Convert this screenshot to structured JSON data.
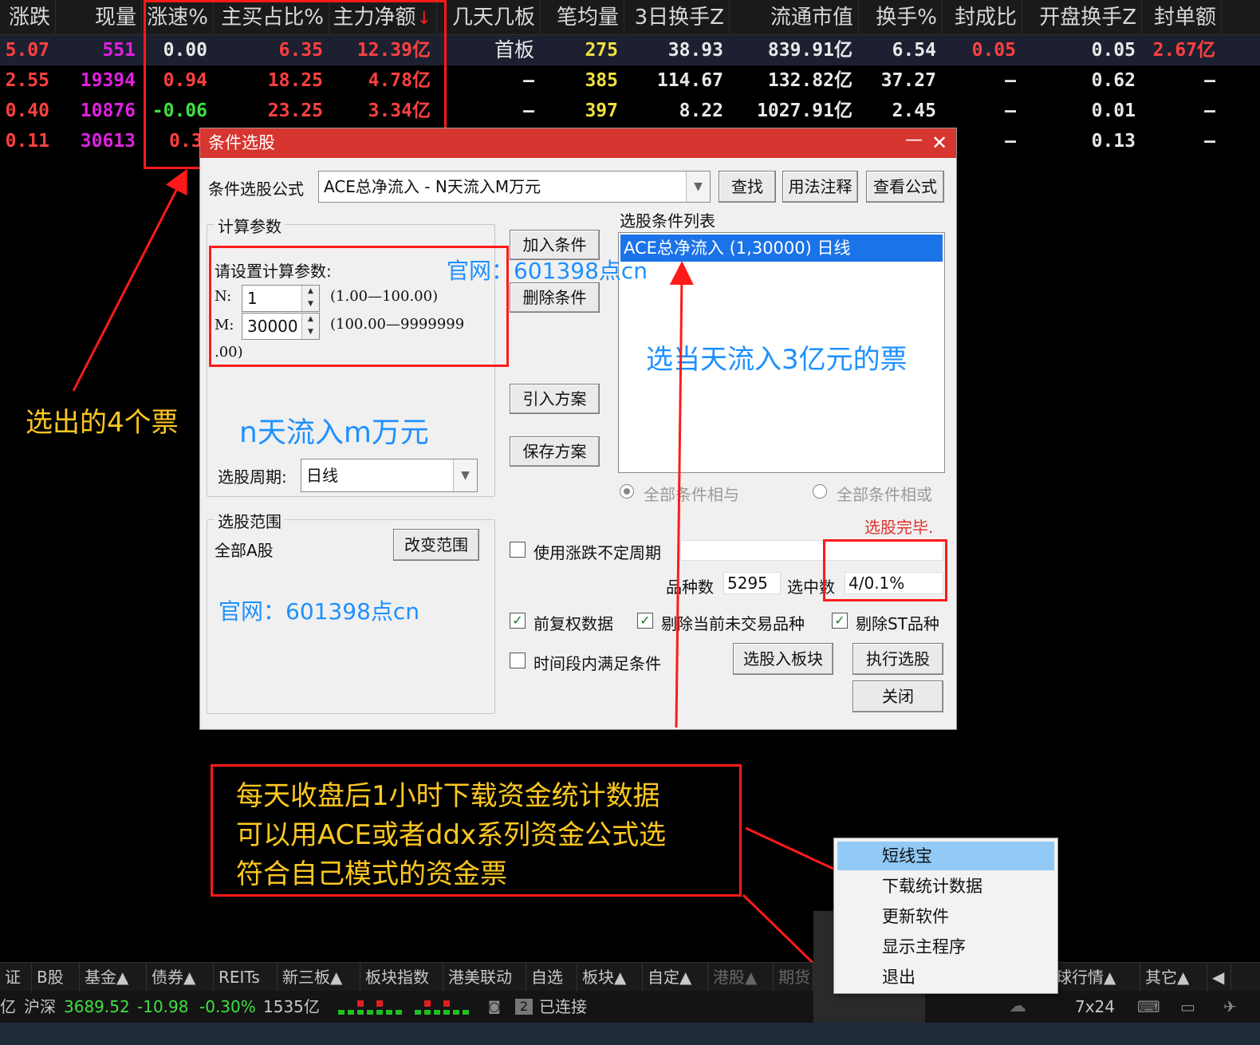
{
  "table": {
    "headers": [
      "涨跌",
      "现量",
      "涨速%",
      "主买占比%",
      "主力净额",
      "几天几板",
      "笔均量",
      "3日换手Z",
      "流通市值",
      "换手%",
      "封成比",
      "开盘换手Z",
      "封单额"
    ],
    "sort_arrow": "↓",
    "rows": [
      [
        "5.07",
        "551",
        "0.00",
        "6.35",
        "12.39亿",
        "首板",
        "275",
        "38.93",
        "839.91亿",
        "6.54",
        "0.05",
        "0.05",
        "2.67亿"
      ],
      [
        "2.55",
        "19394",
        "0.94",
        "18.25",
        "4.78亿",
        "—",
        "385",
        "114.67",
        "132.82亿",
        "37.27",
        "—",
        "0.62",
        "—"
      ],
      [
        "0.40",
        "10876",
        "-0.06",
        "23.25",
        "3.34亿",
        "—",
        "397",
        "8.22",
        "1027.91亿",
        "2.45",
        "—",
        "0.01",
        "—"
      ],
      [
        "0.11",
        "30613",
        "0.3",
        "",
        "",
        "",
        "",
        "",
        "",
        "",
        "—",
        "0.13",
        "—"
      ]
    ]
  },
  "dialog": {
    "title": "条件选股",
    "min_glyph": "—",
    "close_glyph": "✕",
    "formula_label": "条件选股公式",
    "formula_value": "ACE总净流入 - N天流入M万元",
    "find_btn": "查找",
    "usage_btn": "用法注释",
    "view_formula_btn": "查看公式",
    "calc_group": "计算参数",
    "set_params": "请设置计算参数:",
    "n_label": "N:",
    "n_value": "1",
    "n_range": "(1.00—100.00)",
    "m_label": "M:",
    "m_value": "30000",
    "m_range": "(100.00—9999999",
    "m_range_cont": ".00)",
    "add_cond": "加入条件",
    "del_cond": "删除条件",
    "import_plan": "引入方案",
    "save_plan": "保存方案",
    "cond_list_label": "选股条件列表",
    "cond_list_item": "ACE总净流入 (1,30000) 日线",
    "period_label": "选股周期:",
    "period_value": "日线",
    "all_and": "全部条件相与",
    "all_or": "全部条件相或",
    "done_status": "选股完毕.",
    "range_group": "选股范围",
    "range_value": "全部A股",
    "change_range": "改变范围",
    "use_updown_period": "使用涨跌不定周期",
    "count_label": "品种数",
    "count_value": "5295",
    "selected_label": "选中数",
    "selected_value": "4/0.1%",
    "fq_data": "前复权数据",
    "exclude_untraded": "剔除当前未交易品种",
    "exclude_st": "剔除ST品种",
    "time_period_cond": "时间段内满足条件",
    "to_block": "选股入板块",
    "run_select": "执行选股",
    "close_btn": "关闭",
    "check_glyph": "✓"
  },
  "annotations": {
    "selected_4": "选出的4个票",
    "site_1": "官网：601398点cn",
    "site_2": "官网：601398点cn",
    "n_days_m": "n天流入m万元",
    "pick_3yi": "选当天流入3亿元的票",
    "note_line1": "每天收盘后1小时下载资金统计数据",
    "note_line2": "可以用ACE或者ddx系列资金公式选",
    "note_line3": "符合自己模式的资金票"
  },
  "tabs": [
    "证",
    "B股",
    "基金▲",
    "债券▲",
    "REITs",
    "新三板▲",
    "板块指数",
    "港美联动",
    "自选",
    "板块▲",
    "自定▲",
    "港股▲",
    "期货",
    "球行情▲",
    "其它▲"
  ],
  "status": {
    "yi": "亿",
    "market": "沪深",
    "index": "3689.52",
    "change": "-10.98",
    "pct": "-0.30%",
    "amount": "1535亿",
    "conn_num": "2",
    "conn": "已连接",
    "service": "7x24"
  },
  "tray_menu": [
    "短线宝",
    "下载统计数据",
    "更新软件",
    "显示主程序",
    "退出"
  ],
  "colors": {
    "dialog_title": "#d7352f",
    "annotation_red": "#ff1a1a",
    "annotation_yellow": "#ffc820",
    "annotation_blue": "#1e90ff",
    "list_selected": "#1a73e8",
    "menu_highlight": "#91c9f7"
  }
}
